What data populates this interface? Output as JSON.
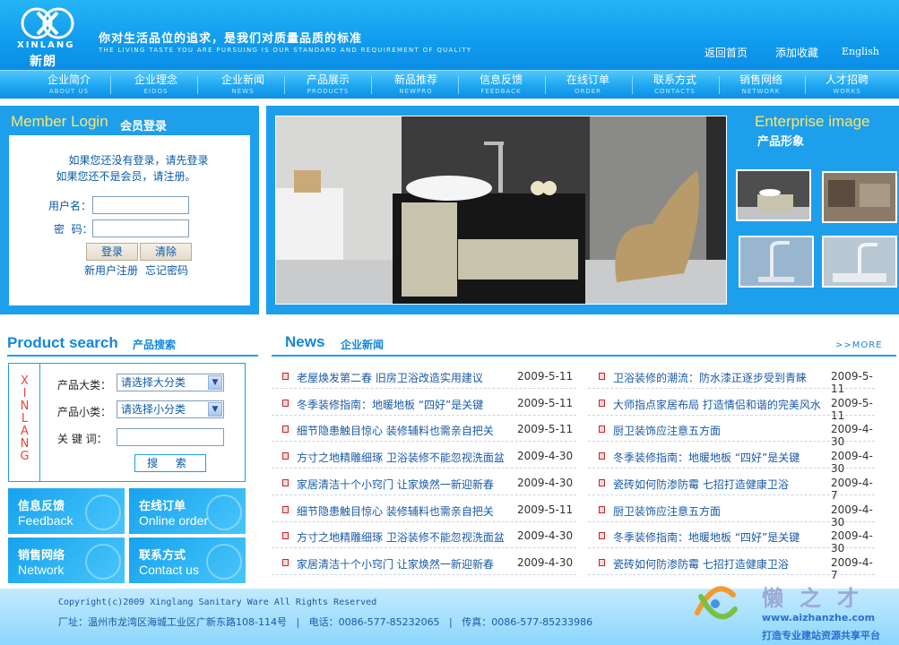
{
  "header": {
    "logo_en": "XINLANG",
    "logo_cn": "新朗",
    "slogan_cn": "你对生活品位的追求，是我们对质量品质的标准",
    "slogan_en": "THE LIVING TASTE YOU ARE PURSUING IS OUR STANDARD AND REQUIREMENT OF QUALITY",
    "links": [
      "返回首页",
      "添加收藏",
      "English"
    ]
  },
  "nav": [
    {
      "cn": "企业简介",
      "en": "ABOUT US"
    },
    {
      "cn": "企业理念",
      "en": "EIDOS"
    },
    {
      "cn": "企业新闻",
      "en": "NEWS"
    },
    {
      "cn": "产品展示",
      "en": "PRODUCTS"
    },
    {
      "cn": "新品推荐",
      "en": "NEWPRO"
    },
    {
      "cn": "信息反馈",
      "en": "FEEDBACK"
    },
    {
      "cn": "在线订单",
      "en": "ORDER"
    },
    {
      "cn": "联系方式",
      "en": "CONTACTS"
    },
    {
      "cn": "销售网络",
      "en": "NETWORK"
    },
    {
      "cn": "人才招聘",
      "en": "WORKS"
    }
  ],
  "login": {
    "title_en": "Member Login",
    "title_cn": "会员登录",
    "tip1": "如果您还没有登录，请先登录",
    "tip2": "如果您还不是会员，请注册。",
    "username_label": "用户名：",
    "password_label": "密  码：",
    "login_button": "登录",
    "clear_button": "清除",
    "register_link": "新用户注册",
    "forgot_link": "忘记密码"
  },
  "showcase": {
    "title_en": "Enterprise image",
    "title_cn": "产品形象"
  },
  "product_search": {
    "title_en": "Product search",
    "title_cn": "产品搜索",
    "vertical_brand": "XINLANG",
    "category_label": "产品大类：",
    "category_value": "请选择大分类",
    "subcategory_label": "产品小类：",
    "subcategory_value": "请选择小分类",
    "keyword_label": "关 键 词：",
    "search_button": "搜 索"
  },
  "quick_links": [
    {
      "cn": "信息反馈",
      "en": "Feedback"
    },
    {
      "cn": "在线订单",
      "en": "Online order"
    },
    {
      "cn": "销售网络",
      "en": "Network"
    },
    {
      "cn": "联系方式",
      "en": "Contact us"
    }
  ],
  "news": {
    "title_en": "News",
    "title_cn": "企业新闻",
    "more": ">>MORE",
    "left": [
      {
        "title": "老屋焕发第二春 旧房卫浴改造实用建议",
        "date": "2009-5-11"
      },
      {
        "title": "冬季装修指南：地暖地板 “四好”是关键",
        "date": "2009-5-11"
      },
      {
        "title": "细节隐患触目惊心 装修辅料也需亲自把关",
        "date": "2009-5-11"
      },
      {
        "title": "方寸之地精雕细琢 卫浴装修不能忽视洗面盆",
        "date": "2009-4-30"
      },
      {
        "title": "家居清洁十个小窍门 让家焕然一新迎新春",
        "date": "2009-4-30"
      },
      {
        "title": "细节隐患触目惊心 装修辅料也需亲自把关",
        "date": "2009-5-11"
      },
      {
        "title": "方寸之地精雕细琢 卫浴装修不能忽视洗面盆",
        "date": "2009-4-30"
      },
      {
        "title": "家居清洁十个小窍门 让家焕然一新迎新春",
        "date": "2009-4-30"
      }
    ],
    "right": [
      {
        "title": "卫浴装修的潮流：防水漆正逐步受到青睐",
        "date": "2009-5-11"
      },
      {
        "title": "大师指点家居布局 打造情侣和谐的完美风水",
        "date": "2009-5-11"
      },
      {
        "title": "厨卫装饰应注意五方面",
        "date": "2009-4-30"
      },
      {
        "title": "冬季装修指南：地暖地板 “四好”是关键",
        "date": "2009-4-30"
      },
      {
        "title": "瓷砖如何防渗防霉 七招打造健康卫浴",
        "date": "2009-4-7"
      },
      {
        "title": "厨卫装饰应注意五方面",
        "date": "2009-4-30"
      },
      {
        "title": "冬季装修指南：地暖地板 “四好”是关键",
        "date": "2009-4-30"
      },
      {
        "title": "瓷砖如何防渗防霉 七招打造健康卫浴",
        "date": "2009-4-7"
      }
    ]
  },
  "footer": {
    "copyright": "Copyright(c)2009 Xinglang Sanitary Ware All Rights Reserved",
    "address": "厂址：温州市龙湾区海城工业区广新东路108-114号   |   电话：0086-577-85232065   |   传真：0086-577-85233986"
  },
  "watermark": {
    "cn": "懒之才",
    "url": "www.aizhanzhe.com",
    "tagline": "打造专业建站资源共享平台"
  }
}
